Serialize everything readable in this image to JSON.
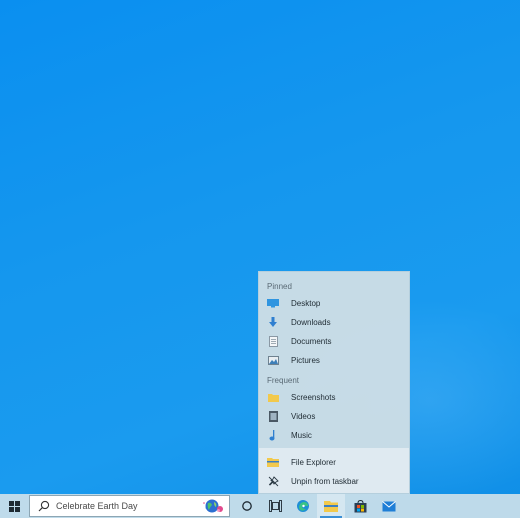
{
  "jumplist": {
    "pinned_header": "Pinned",
    "pinned": [
      {
        "label": "Desktop",
        "icon": "desktop-folder-icon"
      },
      {
        "label": "Downloads",
        "icon": "downloads-folder-icon"
      },
      {
        "label": "Documents",
        "icon": "documents-folder-icon"
      },
      {
        "label": "Pictures",
        "icon": "pictures-folder-icon"
      }
    ],
    "frequent_header": "Frequent",
    "frequent": [
      {
        "label": "Screenshots",
        "icon": "folder-icon"
      },
      {
        "label": "Videos",
        "icon": "videos-folder-icon"
      },
      {
        "label": "Music",
        "icon": "music-folder-icon"
      }
    ],
    "actions": [
      {
        "label": "File Explorer",
        "icon": "file-explorer-icon"
      },
      {
        "label": "Unpin from taskbar",
        "icon": "unpin-icon"
      }
    ]
  },
  "taskbar": {
    "search_placeholder": "Celebrate Earth Day",
    "apps": [
      "cortana",
      "task-view",
      "edge",
      "file-explorer",
      "store",
      "mail"
    ]
  },
  "colors": {
    "desktop": "#1597ee",
    "taskbar": "#c8deea",
    "accent": "#3a8fd6"
  }
}
